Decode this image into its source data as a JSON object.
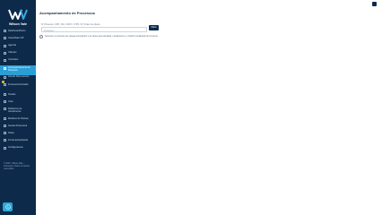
{
  "brand": {
    "name": "Wilson Vale"
  },
  "sidebar": {
    "items": [
      {
        "label": "Dashboard/Inicio"
      },
      {
        "label": "Caixa/Sala VIP"
      },
      {
        "label": "Agenda"
      },
      {
        "label": "Clientes"
      },
      {
        "label": "Contratos"
      },
      {
        "label": "Acompanhamento de Processo"
      },
      {
        "label": "Anexar Documentos"
      },
      {
        "label": "Financeiro/Contabil"
      },
      {
        "label": "Tarefas"
      },
      {
        "label": "Chat"
      },
      {
        "label": "Relatorios de Atendimento"
      },
      {
        "label": "Modelos de Peticao"
      },
      {
        "label": "Gestao Financeira"
      },
      {
        "label": "Notas"
      },
      {
        "label": "Ferramentas/Ajuda"
      },
      {
        "label": "Configuracoes"
      }
    ],
    "footer": "© 2023 - Wilson Vale - Advocacia. Todos os direitos reservados."
  },
  "main": {
    "title": "Acompanhamento de Processos",
    "field_label": "Nº Processo / CPF / RG / CNPJ / CTPS / Nº Ordem de cliente",
    "input_placeholder": "Pesquisar",
    "search_button": "Filtrar",
    "checkbox_label": "Selecione o processo que deseja acompanhar e de clique para visualizar o andamento e o historico atualizado do processo."
  }
}
